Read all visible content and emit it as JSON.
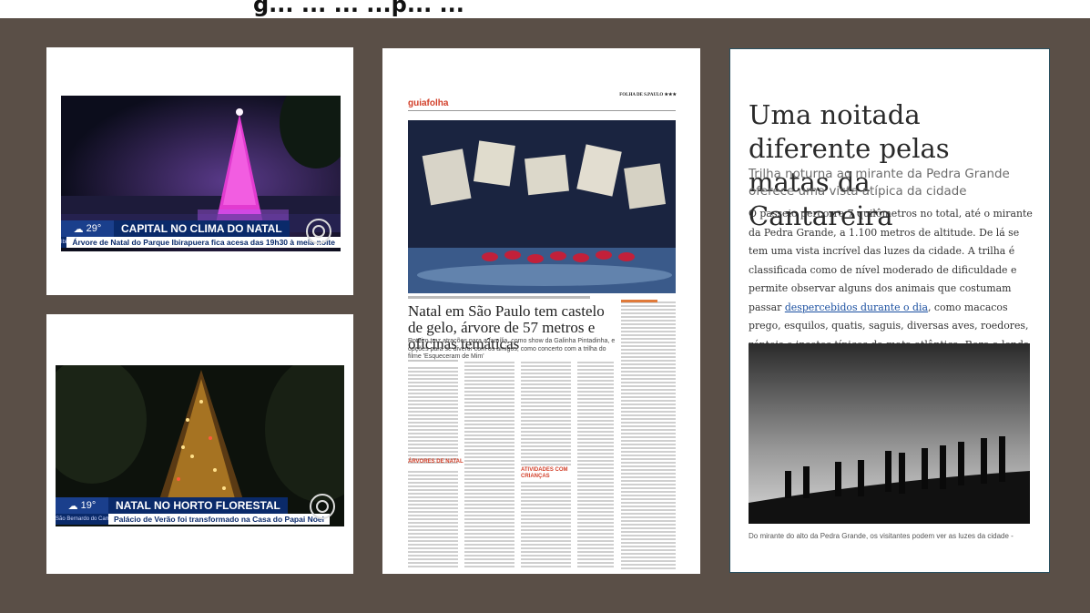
{
  "header": {
    "title": "g... ... ... ...p... ..."
  },
  "cards": {
    "tv1": {
      "temperature": "29°",
      "place": "Ibirapuera",
      "headline": "CAPITAL NO CLIMA DO NATAL",
      "subline": "Árvore de Natal do Parque Ibirapuera fica acesa das 19h30 à meia-noite"
    },
    "tv2": {
      "temperature": "19°",
      "place": "São Bernardo do Campo",
      "headline": "NATAL NO HORTO FLORESTAL",
      "subline": "Palácio de Verão foi transformado na Casa do Papai Noel"
    }
  },
  "newspaper": {
    "masthead": "guiafolha",
    "top_right": "FOLHA DE S.PAULO ★★★",
    "headline": "Natal em São Paulo tem castelo de gelo, árvore de 57 metros e oficinas temáticas",
    "dek": "Roteiro traz atrações para a família, como show da Galinha Pintadinha, e opções para se divertir com os amigos, como concerto com a trilha do filme 'Esqueceram de Mim'",
    "section1": "ÁRVORES DE NATAL",
    "section2": "ATIVIDADES COM CRIANÇAS"
  },
  "article": {
    "title": "Uma noitada diferente pelas matas da Cantareira",
    "subtitle": "Trilha noturna ao mirante da Pedra Grande oferece uma vista atípica da cidade",
    "body_before_link": "O passeio percorre 7 quilômetros no total, até o mirante da Pedra Grande, a 1.100 metros de altitude. De lá se tem uma vista incrível das luzes da cidade. A trilha é classificada como de nível moderado de dificuldade e permite observar alguns dos animais que costumam passar ",
    "body_link": "despercebidos durante o dia",
    "body_after_link": ", como macacos prego, esquilos, quatis, saguis, diversas aves, roedores, répteis e insetos típicos da mata atlântica. Reza a lenda que no parque tem até onças, mas elas não são bobas nem nada para ficarem dando mole em meio a um bando de turistas barulhentos. Tranquilos, pois.",
    "caption": "Do mirante do alto da Pedra Grande, os visitantes podem ver as luzes da cidade -"
  }
}
